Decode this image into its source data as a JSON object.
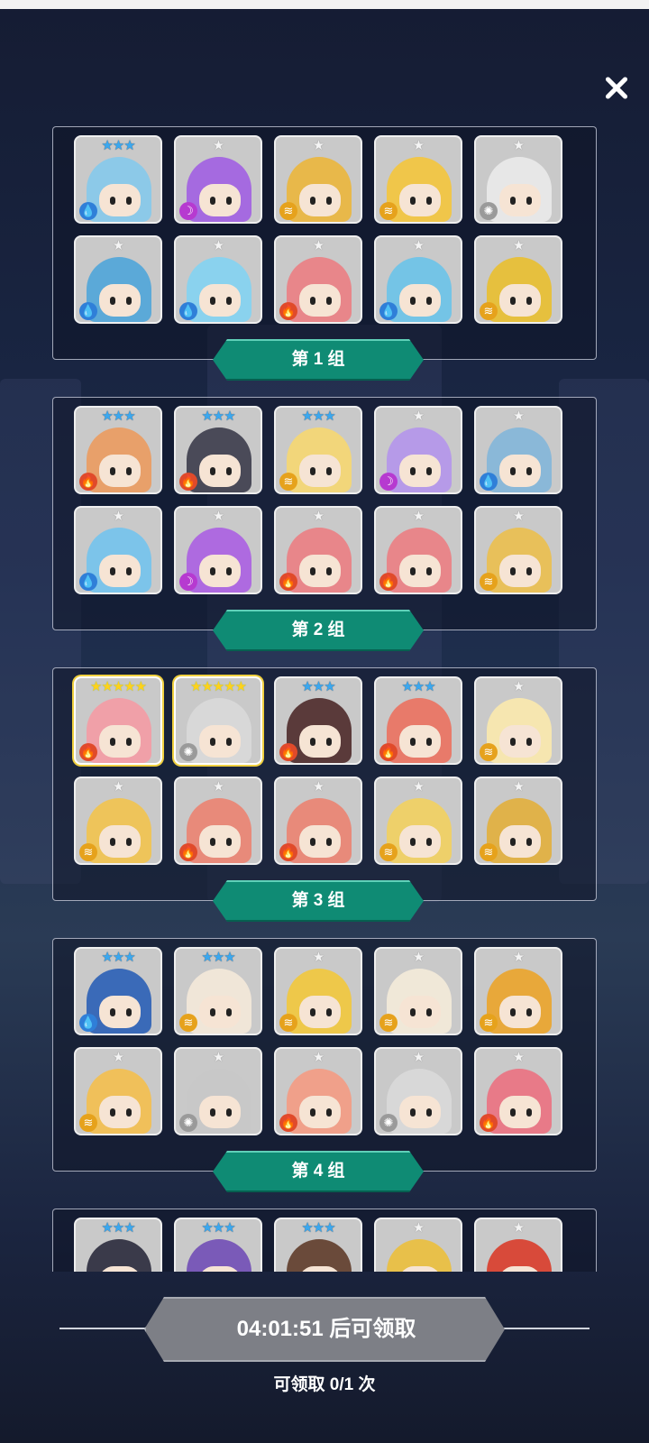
{
  "dialog": {
    "close_icon": "close-icon"
  },
  "groups": [
    {
      "label": "第 1 组",
      "heroes": [
        {
          "stars": 3,
          "tier": "blue",
          "element": "water",
          "color": "#8cc9e8"
        },
        {
          "stars": 1,
          "tier": "silver",
          "element": "moon",
          "color": "#a56ae0"
        },
        {
          "stars": 1,
          "tier": "silver",
          "element": "wind",
          "color": "#e8b84a"
        },
        {
          "stars": 1,
          "tier": "silver",
          "element": "wind",
          "color": "#f0c64a"
        },
        {
          "stars": 1,
          "tier": "silver",
          "element": "light",
          "color": "#e7e7e7"
        },
        {
          "stars": 1,
          "tier": "silver",
          "element": "water",
          "color": "#5ba9d8"
        },
        {
          "stars": 1,
          "tier": "silver",
          "element": "water",
          "color": "#8ad2ee"
        },
        {
          "stars": 1,
          "tier": "silver",
          "element": "fire",
          "color": "#e8868a"
        },
        {
          "stars": 1,
          "tier": "silver",
          "element": "water",
          "color": "#74c4e6"
        },
        {
          "stars": 1,
          "tier": "silver",
          "element": "wind",
          "color": "#e6c03e"
        }
      ]
    },
    {
      "label": "第 2 组",
      "heroes": [
        {
          "stars": 3,
          "tier": "blue",
          "element": "fire",
          "color": "#e8a06a"
        },
        {
          "stars": 3,
          "tier": "blue",
          "element": "fire",
          "color": "#4a4a58"
        },
        {
          "stars": 3,
          "tier": "blue",
          "element": "wind",
          "color": "#f2d67a"
        },
        {
          "stars": 1,
          "tier": "silver",
          "element": "moon",
          "color": "#b69ae8"
        },
        {
          "stars": 1,
          "tier": "silver",
          "element": "water",
          "color": "#8ab8d8"
        },
        {
          "stars": 1,
          "tier": "silver",
          "element": "water",
          "color": "#7cc4ea"
        },
        {
          "stars": 1,
          "tier": "silver",
          "element": "moon",
          "color": "#ae6ae0"
        },
        {
          "stars": 1,
          "tier": "silver",
          "element": "fire",
          "color": "#e8868a"
        },
        {
          "stars": 1,
          "tier": "silver",
          "element": "fire",
          "color": "#e8868a"
        },
        {
          "stars": 1,
          "tier": "silver",
          "element": "wind",
          "color": "#e8c05a"
        }
      ]
    },
    {
      "label": "第 3 组",
      "heroes": [
        {
          "stars": 5,
          "tier": "gold",
          "element": "fire",
          "color": "#f0a0a8"
        },
        {
          "stars": 5,
          "tier": "gold",
          "element": "light",
          "color": "#d8d8d8"
        },
        {
          "stars": 3,
          "tier": "blue",
          "element": "fire",
          "color": "#5a3a3a"
        },
        {
          "stars": 3,
          "tier": "blue",
          "element": "fire",
          "color": "#e87a6a"
        },
        {
          "stars": 1,
          "tier": "silver",
          "element": "wind",
          "color": "#f6e6b0"
        },
        {
          "stars": 1,
          "tier": "silver",
          "element": "wind",
          "color": "#eec45a"
        },
        {
          "stars": 1,
          "tier": "silver",
          "element": "fire",
          "color": "#e88a7a"
        },
        {
          "stars": 1,
          "tier": "silver",
          "element": "fire",
          "color": "#e88a7a"
        },
        {
          "stars": 1,
          "tier": "silver",
          "element": "wind",
          "color": "#eed06a"
        },
        {
          "stars": 1,
          "tier": "silver",
          "element": "wind",
          "color": "#e0b24a"
        }
      ]
    },
    {
      "label": "第 4 组",
      "heroes": [
        {
          "stars": 3,
          "tier": "blue",
          "element": "water",
          "color": "#3a6ab8"
        },
        {
          "stars": 3,
          "tier": "blue",
          "element": "wind",
          "color": "#f0e6d8"
        },
        {
          "stars": 1,
          "tier": "silver",
          "element": "wind",
          "color": "#eec84a"
        },
        {
          "stars": 1,
          "tier": "silver",
          "element": "wind",
          "color": "#f0e8d8"
        },
        {
          "stars": 1,
          "tier": "silver",
          "element": "wind",
          "color": "#e8a83a"
        },
        {
          "stars": 1,
          "tier": "silver",
          "element": "wind",
          "color": "#f0c05a"
        },
        {
          "stars": 1,
          "tier": "silver",
          "element": "light",
          "color": "#c8c8c8"
        },
        {
          "stars": 1,
          "tier": "silver",
          "element": "fire",
          "color": "#f0a08a"
        },
        {
          "stars": 1,
          "tier": "silver",
          "element": "light",
          "color": "#d8d8d8"
        },
        {
          "stars": 1,
          "tier": "silver",
          "element": "fire",
          "color": "#e87a88"
        }
      ]
    },
    {
      "label": "",
      "heroes": [
        {
          "stars": 3,
          "tier": "blue",
          "element": "",
          "color": "#3a3a4a"
        },
        {
          "stars": 3,
          "tier": "blue",
          "element": "",
          "color": "#7a5ab8"
        },
        {
          "stars": 3,
          "tier": "blue",
          "element": "",
          "color": "#6a4a3a"
        },
        {
          "stars": 1,
          "tier": "silver",
          "element": "",
          "color": "#e8c04a"
        },
        {
          "stars": 1,
          "tier": "silver",
          "element": "",
          "color": "#d84a3a"
        }
      ]
    }
  ],
  "footer": {
    "timer_text": "04:01:51 后可领取",
    "claim_count_text": "可领取 0/1 次"
  }
}
